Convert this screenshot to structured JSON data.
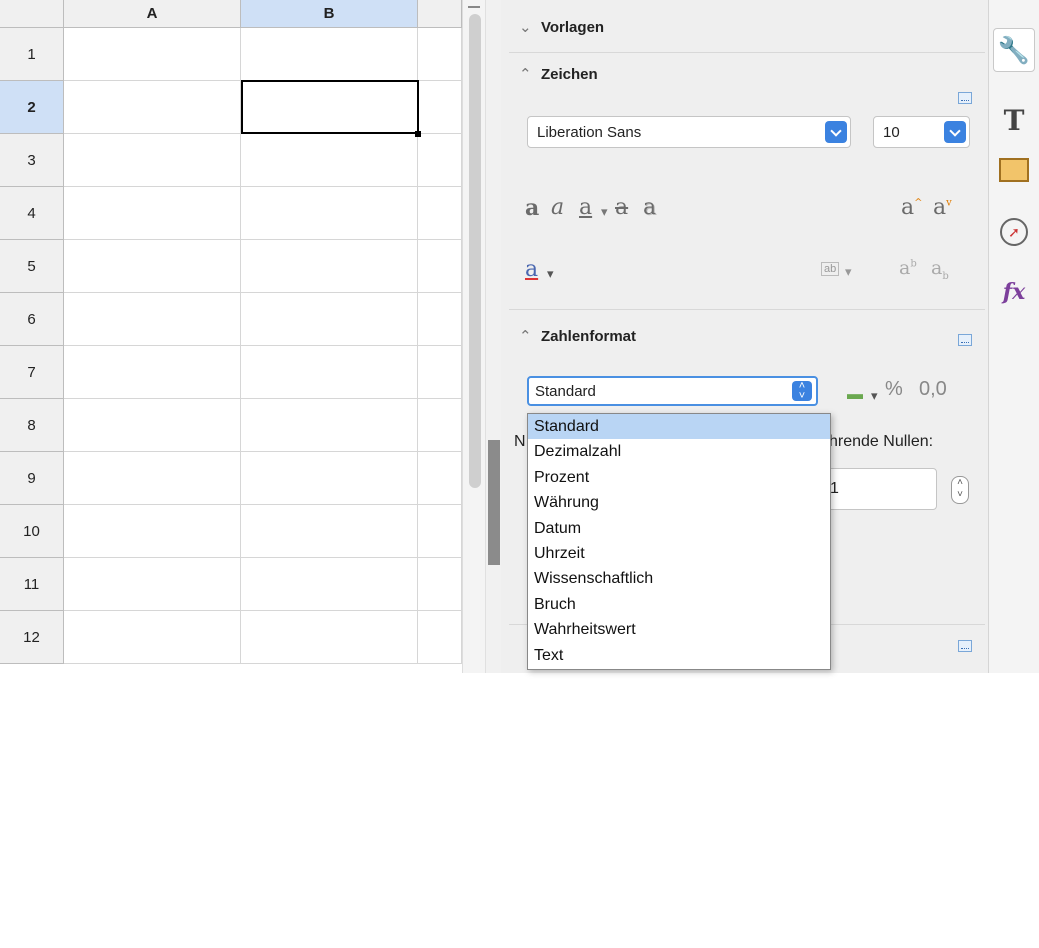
{
  "sheet": {
    "columns": [
      "A",
      "B"
    ],
    "rows": [
      "1",
      "2",
      "3",
      "4",
      "5",
      "6",
      "7",
      "8",
      "9",
      "10",
      "11",
      "12"
    ],
    "selected_column": "B",
    "selected_row": "2"
  },
  "sidebar": {
    "sections": {
      "vorlagen": "Vorlagen",
      "zeichen": "Zeichen",
      "zahlenformat": "Zahlenformat"
    },
    "font_name": "Liberation Sans",
    "font_size": "10",
    "percent_symbol": "%",
    "decimal_symbol": "0,0",
    "number_format": {
      "selected": "Standard",
      "options": [
        "Standard",
        "Dezimalzahl",
        "Prozent",
        "Währung",
        "Datum",
        "Uhrzeit",
        "Wissenschaftlich",
        "Bruch",
        "Wahrheitswert",
        "Text"
      ]
    },
    "partial_label_left": "N",
    "partial_label_right": "hrende Nullen:",
    "partial_value": "1"
  },
  "tabs": [
    "wrench-icon",
    "character-icon",
    "frame-icon",
    "navigator-icon",
    "functions-icon"
  ]
}
